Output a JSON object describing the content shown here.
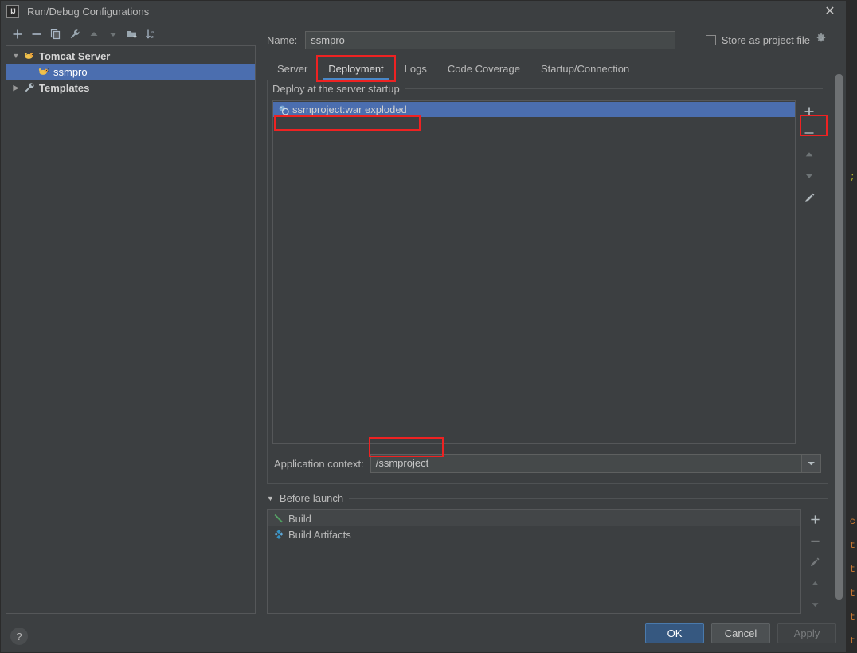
{
  "window": {
    "title": "Run/Debug Configurations",
    "app_icon": "intellij-idea-icon",
    "close_icon": "close-icon"
  },
  "left_toolbar": {
    "buttons": [
      {
        "name": "add-configuration-button",
        "icon": "plus-icon",
        "tooltip": "Add New Configuration"
      },
      {
        "name": "remove-configuration-button",
        "icon": "minus-icon",
        "tooltip": "Remove Configuration"
      },
      {
        "name": "copy-configuration-button",
        "icon": "copy-icon",
        "tooltip": "Copy Configuration"
      },
      {
        "name": "edit-templates-button",
        "icon": "wrench-icon",
        "tooltip": "Edit Templates"
      },
      {
        "name": "move-up-button",
        "icon": "arrow-up-icon",
        "tooltip": "Move Up"
      },
      {
        "name": "move-down-button",
        "icon": "arrow-down-icon",
        "tooltip": "Move Down"
      },
      {
        "name": "new-folder-button",
        "icon": "folder-add-icon",
        "tooltip": "Create New Folder"
      },
      {
        "name": "sort-button",
        "icon": "sort-alphabetically-icon",
        "tooltip": "Sort Configurations"
      }
    ]
  },
  "tree": {
    "items": [
      {
        "label": "Tomcat Server",
        "icon": "tomcat-icon",
        "expanded": true,
        "arrow": "chevron-down-icon",
        "level": 0,
        "selected": false,
        "bold": true
      },
      {
        "label": "ssmpro",
        "icon": "tomcat-icon",
        "arrow": "",
        "level": 1,
        "selected": true,
        "bold": false
      },
      {
        "label": "Templates",
        "icon": "wrench-icon",
        "expanded": false,
        "arrow": "chevron-right-icon",
        "level": 0,
        "selected": false,
        "bold": true
      }
    ]
  },
  "help": {
    "icon": "question-mark-icon",
    "label": "?"
  },
  "name_row": {
    "label": "Name:",
    "value": "ssmpro",
    "placeholder": "",
    "store_as_project_file": {
      "label": "Store as project file",
      "checked": false,
      "gear_icon": "gear-icon"
    }
  },
  "tabs": [
    {
      "label": "Server",
      "active": false,
      "highlighted": false
    },
    {
      "label": "Deployment",
      "active": true,
      "highlighted": true
    },
    {
      "label": "Logs",
      "active": false,
      "highlighted": false
    },
    {
      "label": "Code Coverage",
      "active": false,
      "highlighted": false
    },
    {
      "label": "Startup/Connection",
      "active": false,
      "highlighted": false
    }
  ],
  "deployment": {
    "group_title": "Deploy at the server startup",
    "artifacts": [
      {
        "label": "ssmproject:war exploded",
        "icon": "artifact-icon",
        "selected": true,
        "highlighted": true
      }
    ],
    "side_buttons": [
      {
        "name": "deploy-add-button",
        "icon": "plus-icon",
        "highlighted": true
      },
      {
        "name": "deploy-remove-button",
        "icon": "minus-icon",
        "highlighted": false
      },
      {
        "name": "deploy-move-up-button",
        "icon": "arrow-up-icon",
        "highlighted": false
      },
      {
        "name": "deploy-move-down-button",
        "icon": "arrow-down-icon",
        "highlighted": false
      },
      {
        "name": "deploy-edit-button",
        "icon": "pencil-icon",
        "highlighted": false
      }
    ],
    "application_context": {
      "label": "Application context:",
      "value": "/ssmproject",
      "highlighted": true,
      "dropdown_icon": "chevron-down-icon"
    }
  },
  "before_launch": {
    "title": "Before launch",
    "caret_icon": "caret-down-icon",
    "tasks": [
      {
        "label": "Build",
        "icon": "build-hammer-icon",
        "icon_color": "#59a869"
      },
      {
        "label": "Build Artifacts",
        "icon": "artifact-diamond-icon",
        "icon_color": "#3592c4"
      }
    ],
    "side_buttons": [
      {
        "name": "before-launch-add-button",
        "icon": "plus-icon"
      },
      {
        "name": "before-launch-remove-button",
        "icon": "minus-icon"
      },
      {
        "name": "before-launch-edit-button",
        "icon": "pencil-icon"
      },
      {
        "name": "before-launch-move-up-button",
        "icon": "arrow-up-icon"
      },
      {
        "name": "before-launch-move-down-button",
        "icon": "arrow-down-icon"
      }
    ]
  },
  "footer": {
    "ok": "OK",
    "cancel": "Cancel",
    "apply": "Apply",
    "apply_enabled": false
  },
  "colors": {
    "dialog_bg": "#3c3f41",
    "selection_blue": "#4b6eaf",
    "tab_underline": "#4a88c7",
    "annotation_red": "#ee2222",
    "ok_button": "#365880",
    "text": "#bbbbbb"
  },
  "background_ide": {
    "code_fragments": [
      "c",
      "t",
      "t",
      "t",
      "t"
    ]
  }
}
